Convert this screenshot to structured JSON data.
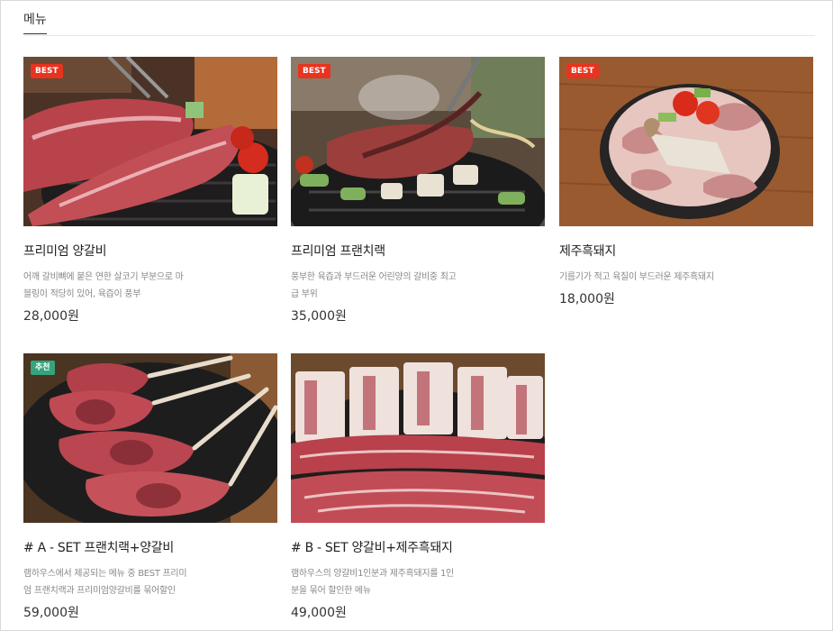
{
  "section_title": "메뉴",
  "colors": {
    "best_badge": "#e8331f",
    "recommend_badge": "#35a37b"
  },
  "items": [
    {
      "badge": "BEST",
      "name": "프리미엄 양갈비",
      "description": "어깨 갈비뼈에 붙은 연한 살코기 부분으로 마블링이 적당히 있어, 육즙이 풍부",
      "price": "28,000원"
    },
    {
      "badge": "BEST",
      "name": "프리미엄 프랜치랙",
      "description": "풍부한 육즙과 부드러운 어린양의 갈비중 최고급 부위",
      "price": "35,000원"
    },
    {
      "badge": "BEST",
      "name": "제주흑돼지",
      "description": "기름기가 적고 육질이 부드러운 제주흑돼지",
      "price": "18,000원"
    },
    {
      "badge": "추천",
      "name": "# A - SET 프랜치랙+양갈비",
      "description": "램하우스에서 제공되는 메뉴 중 BEST 프리미엄 프랜치랙과 프리미엄양갈비를 묶어할인",
      "price": "59,000원"
    },
    {
      "badge": "",
      "name": "# B - SET 양갈비+제주흑돼지",
      "description": "램하우스의 양갈비1인분과 제주흑돼지를 1인분을 묶어 할인한 메뉴",
      "price": "49,000원"
    }
  ]
}
